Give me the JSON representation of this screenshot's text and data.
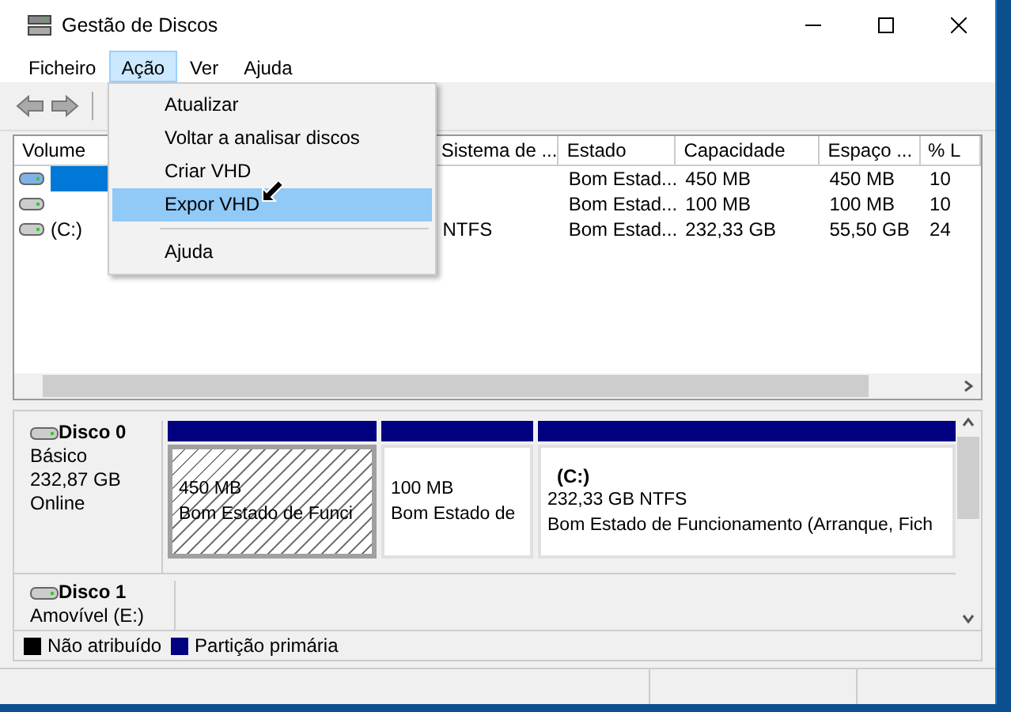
{
  "window": {
    "title": "Gestão de Discos"
  },
  "menu_bar": [
    {
      "label": "Ficheiro",
      "selected": false
    },
    {
      "label": "Ação",
      "selected": true
    },
    {
      "label": "Ver",
      "selected": false
    },
    {
      "label": "Ajuda",
      "selected": false
    }
  ],
  "dropdown": [
    {
      "kind": "item",
      "label": "Atualizar",
      "selected": false
    },
    {
      "kind": "item",
      "label": "Voltar a analisar discos",
      "selected": false
    },
    {
      "kind": "item",
      "label": "Criar VHD",
      "selected": false
    },
    {
      "kind": "item",
      "label": "Expor VHD",
      "selected": true
    },
    {
      "kind": "separator"
    },
    {
      "kind": "item",
      "label": "Ajuda",
      "selected": false
    }
  ],
  "volume_table": {
    "columns": [
      "Volume",
      "Sistema de ...",
      "Estado",
      "Capacidade",
      "Espaço ...",
      "% L"
    ],
    "rows": [
      {
        "selected": true,
        "cells": [
          null,
          null,
          "Bom Estad...",
          "450 MB",
          "450 MB",
          "10"
        ]
      },
      {
        "selected": false,
        "cells": [
          null,
          null,
          "Bom Estad...",
          "100 MB",
          "100 MB",
          "10"
        ]
      },
      {
        "selected": false,
        "cells": [
          "(C:)",
          "NTFS",
          "Bom Estad...",
          "232,33 GB",
          "55,50 GB",
          "24"
        ]
      }
    ]
  },
  "disks": [
    {
      "name": "Disco 0",
      "lines": [
        "Básico",
        "232,87 GB",
        "Online"
      ],
      "partitions": [
        {
          "size": "450 MB",
          "status": "Bom Estado de Funci",
          "selected": true
        },
        {
          "size": "100 MB",
          "status": "Bom Estado de",
          "selected": false
        },
        {
          "label": "(C:)",
          "size": "232,33 GB NTFS",
          "status": "Bom Estado de Funcionamento (Arranque, Fich",
          "selected": false
        }
      ]
    },
    {
      "name": "Disco 1",
      "lines": [
        "Amovível (E:)"
      ]
    }
  ],
  "legend": [
    {
      "label": "Não atribuído",
      "color": "#000000"
    },
    {
      "label": "Partição primária",
      "color": "#000080"
    }
  ]
}
